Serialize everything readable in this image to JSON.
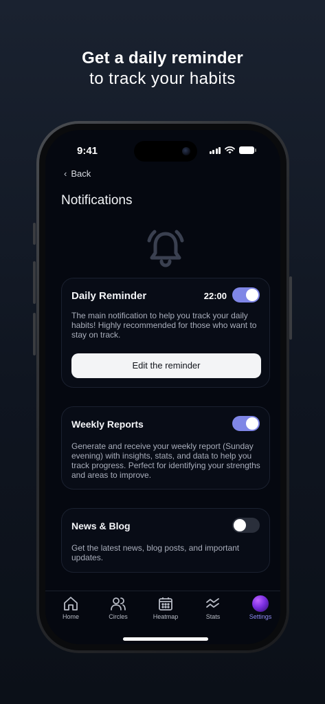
{
  "headline": {
    "line1": "Get a daily reminder",
    "line2": "to track your habits"
  },
  "status_bar": {
    "time": "9:41"
  },
  "nav": {
    "back_label": "Back",
    "title": "Notifications"
  },
  "cards": {
    "daily": {
      "title": "Daily Reminder",
      "time": "22:00",
      "enabled": true,
      "description": "The main notification to help you track your daily habits! Highly recommended for those who want to stay on track.",
      "button_label": "Edit the reminder"
    },
    "weekly": {
      "title": "Weekly Reports",
      "enabled": true,
      "description": "Generate and receive your weekly report (Sunday evening) with insights, stats, and data to help you track progress. Perfect for identifying your strengths and areas to improve."
    },
    "news": {
      "title": "News & Blog",
      "enabled": false,
      "description": "Get the latest news, blog posts, and important updates."
    }
  },
  "tabbar": {
    "home": "Home",
    "circles": "Circles",
    "heatmap": "Heatmap",
    "stats": "Stats",
    "settings": "Settings",
    "active": "settings"
  },
  "colors": {
    "accent": "#7f86e6",
    "active_tab": "#8e8cf0",
    "background": "#050810"
  }
}
